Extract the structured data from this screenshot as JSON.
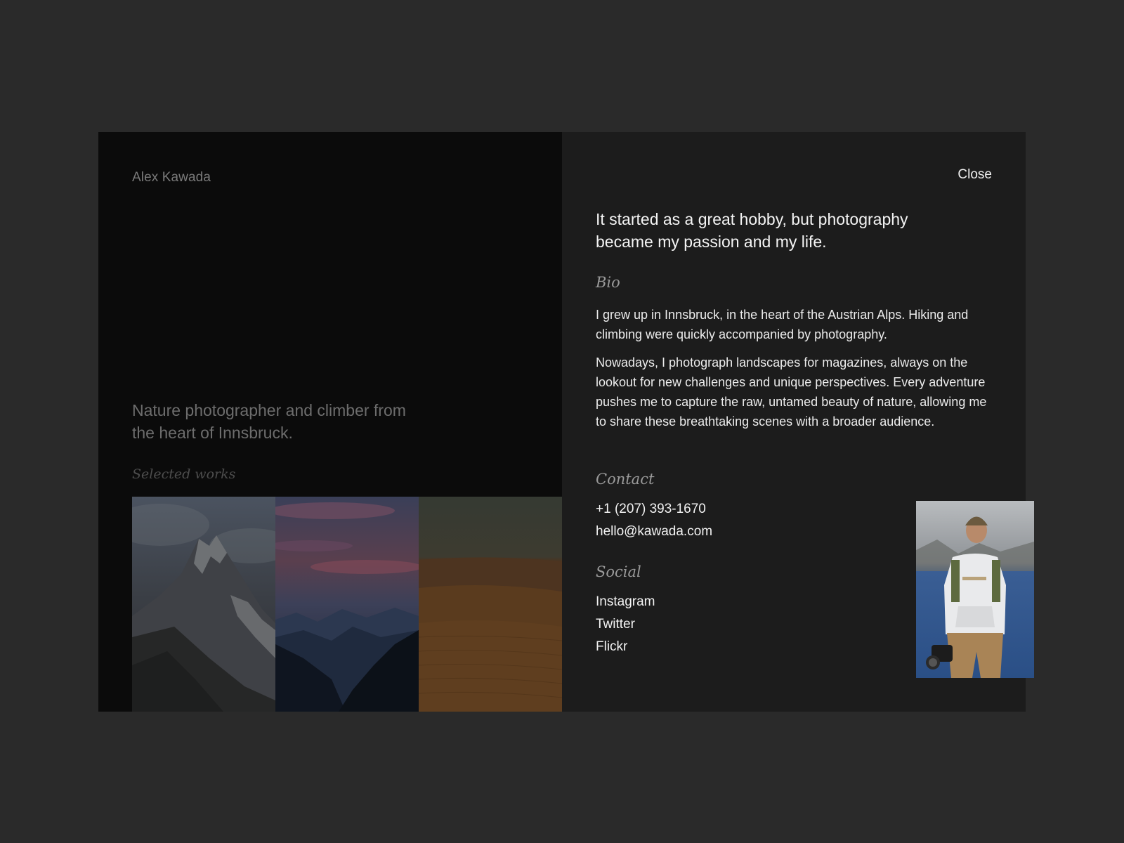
{
  "brand": "Alex Kawada",
  "tagline": "Nature photographer and climber from the heart of Innsbruck.",
  "selected_works_label": "Selected works",
  "gallery": [
    {
      "name": "mountain-peak-photo"
    },
    {
      "name": "twilight-ridges-photo"
    },
    {
      "name": "desert-dunes-photo"
    }
  ],
  "close_label": "Close",
  "headline": "It started as a great hobby, but photography became my passion and my life.",
  "bio": {
    "label": "Bio",
    "paragraphs": [
      "I grew up in Innsbruck, in the heart of the Austrian Alps. Hiking and climbing were quickly accompanied by photography.",
      "Nowadays, I photograph landscapes for magazines, always on the lookout for new challenges and unique perspectives. Every adventure pushes me to capture the raw, untamed beauty of nature, allowing me to share these breathtaking scenes with a broader audience."
    ]
  },
  "contact": {
    "label": "Contact",
    "phone": "+1 (207) 393-1670",
    "email": "hello@kawada.com"
  },
  "social": {
    "label": "Social",
    "links": [
      "Instagram",
      "Twitter",
      "Flickr"
    ]
  },
  "colors": {
    "page_background": "#2a2a2a",
    "left_panel": "#0b0b0b",
    "right_panel": "#1c1c1c",
    "text_primary": "#f2f2f2",
    "text_muted": "#6d6d6d"
  }
}
